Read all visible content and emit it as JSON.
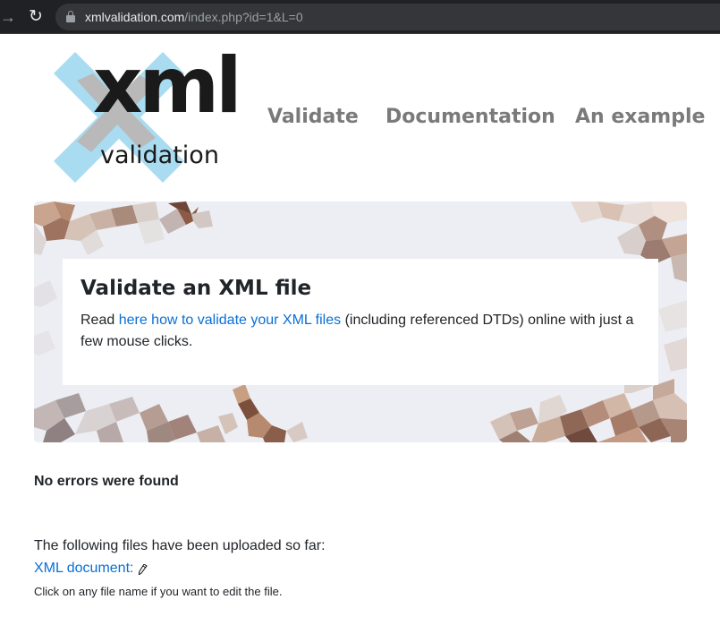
{
  "browser": {
    "url_domain": "xmlvalidation.com",
    "url_path": "/index.php?id=1&L=0",
    "forward_glyph": "→",
    "reload_glyph": "↻"
  },
  "logo": {
    "word_main": "xml",
    "word_sub": "validation",
    "cross_color": "#a9dcf0",
    "shade_color": "#b9b9b9"
  },
  "nav": {
    "items": [
      {
        "label": "Validate"
      },
      {
        "label": "Documentation"
      },
      {
        "label": "An example"
      }
    ]
  },
  "hero": {
    "title": "Validate an XML file",
    "text_before": "Read ",
    "link_text": "here how to validate your XML files",
    "text_after": " (including referenced DTDs) online with just a few mouse clicks."
  },
  "result": {
    "status": "No errors were found",
    "uploaded_intro": "The following files have been uploaded so far:",
    "file_link": "XML document:",
    "edit_hint": "Click on any file name if you want to edit the file."
  },
  "icons": {
    "lock": "lock-icon",
    "pencil": "pencil-icon"
  },
  "colors": {
    "link": "#0a6fd6",
    "nav": "#7a7a7a",
    "browser_bar": "#202124"
  }
}
